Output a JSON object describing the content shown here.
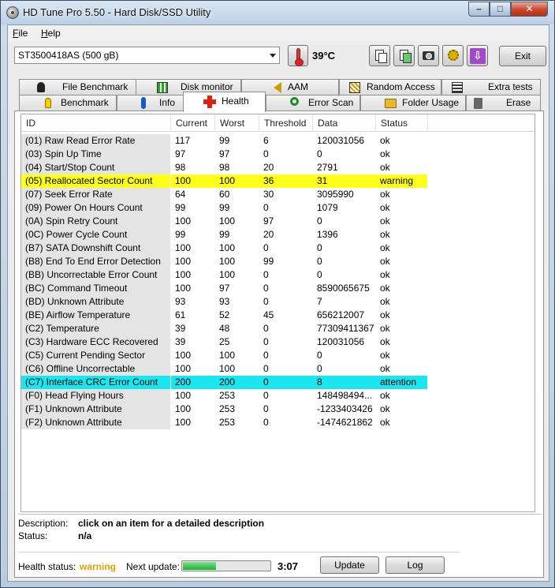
{
  "window": {
    "title": "HD Tune Pro 5.50 - Hard Disk/SSD Utility",
    "min_glyph": "–",
    "max_glyph": "□",
    "close_glyph": "✕"
  },
  "menu": {
    "file_prefix": "",
    "file_u": "F",
    "file_rest": "ile",
    "help_u": "H",
    "help_rest": "elp"
  },
  "toolbar": {
    "drive": "ST3500418AS (500 gB)",
    "temperature": "39°C",
    "save_glyph": "⇩",
    "exit": "Exit"
  },
  "tabs": {
    "row1": [
      "File Benchmark",
      "Disk monitor",
      "AAM",
      "Random Access",
      "Extra tests"
    ],
    "row2": [
      "Benchmark",
      "Info",
      "Health",
      "Error Scan",
      "Folder Usage",
      "Erase"
    ],
    "active": "Health"
  },
  "table": {
    "headers": [
      "ID",
      "Current",
      "Worst",
      "Threshold",
      "Data",
      "Status"
    ],
    "rows": [
      [
        "(01) Raw Read Error Rate",
        "117",
        "99",
        "6",
        "120031056",
        "ok"
      ],
      [
        "(03) Spin Up Time",
        "97",
        "97",
        "0",
        "0",
        "ok"
      ],
      [
        "(04) Start/Stop Count",
        "98",
        "98",
        "20",
        "2791",
        "ok"
      ],
      [
        "(05) Reallocated Sector Count",
        "100",
        "100",
        "36",
        "31",
        "warning"
      ],
      [
        "(07) Seek Error Rate",
        "64",
        "60",
        "30",
        "3095990",
        "ok"
      ],
      [
        "(09) Power On Hours Count",
        "99",
        "99",
        "0",
        "1079",
        "ok"
      ],
      [
        "(0A) Spin Retry Count",
        "100",
        "100",
        "97",
        "0",
        "ok"
      ],
      [
        "(0C) Power Cycle Count",
        "99",
        "99",
        "20",
        "1396",
        "ok"
      ],
      [
        "(B7) SATA Downshift Count",
        "100",
        "100",
        "0",
        "0",
        "ok"
      ],
      [
        "(B8) End To End Error Detection",
        "100",
        "100",
        "99",
        "0",
        "ok"
      ],
      [
        "(BB) Uncorrectable Error Count",
        "100",
        "100",
        "0",
        "0",
        "ok"
      ],
      [
        "(BC) Command Timeout",
        "100",
        "97",
        "0",
        "8590065675",
        "ok"
      ],
      [
        "(BD) Unknown Attribute",
        "93",
        "93",
        "0",
        "7",
        "ok"
      ],
      [
        "(BE) Airflow Temperature",
        "61",
        "52",
        "45",
        "656212007",
        "ok"
      ],
      [
        "(C2) Temperature",
        "39",
        "48",
        "0",
        "77309411367",
        "ok"
      ],
      [
        "(C3) Hardware ECC Recovered",
        "39",
        "25",
        "0",
        "120031056",
        "ok"
      ],
      [
        "(C5) Current Pending Sector",
        "100",
        "100",
        "0",
        "0",
        "ok"
      ],
      [
        "(C6) Offline Uncorrectable",
        "100",
        "100",
        "0",
        "0",
        "ok"
      ],
      [
        "(C7) Interface CRC Error Count",
        "200",
        "200",
        "0",
        "8",
        "attention"
      ],
      [
        "(F0) Head Flying Hours",
        "100",
        "253",
        "0",
        "148498494...",
        "ok"
      ],
      [
        "(F1) Unknown Attribute",
        "100",
        "253",
        "0",
        "-1233403426",
        "ok"
      ],
      [
        "(F2) Unknown Attribute",
        "100",
        "253",
        "0",
        "-1474621862",
        "ok"
      ]
    ]
  },
  "description": {
    "label": "Description:",
    "value": "click on an item for a detailed description",
    "status_label": "Status:",
    "status_value": "n/a"
  },
  "footer": {
    "health_label": "Health status:",
    "health_value": "warning",
    "next_label": "Next update:",
    "progress_fraction": 0.38,
    "countdown": "3:07",
    "update": "Update",
    "log": "Log"
  },
  "colors": {
    "warning_row": "#ffff1a",
    "attention_row": "#1ae6f0",
    "health_warning": "#e0a000"
  }
}
